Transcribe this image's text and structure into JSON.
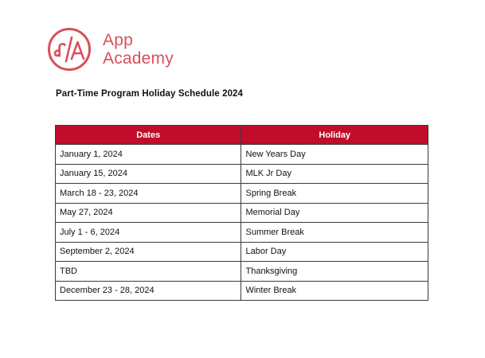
{
  "brand": {
    "mark_text": "a/A",
    "name_line1": "App",
    "name_line2": "Academy",
    "color": "#d8505a"
  },
  "document": {
    "title": "Part-Time Program Holiday Schedule 2024"
  },
  "table": {
    "header_color": "#c00d2a",
    "columns": [
      "Dates",
      "Holiday"
    ],
    "rows": [
      [
        "January 1, 2024",
        "New Years Day"
      ],
      [
        "January 15, 2024",
        "MLK Jr Day"
      ],
      [
        "March 18 - 23, 2024",
        "Spring Break"
      ],
      [
        "May 27, 2024",
        "Memorial Day"
      ],
      [
        "July 1 - 6, 2024",
        "Summer Break"
      ],
      [
        "September 2, 2024",
        "Labor Day"
      ],
      [
        "TBD",
        "Thanksgiving"
      ],
      [
        "December 23 - 28, 2024",
        "Winter Break"
      ]
    ]
  }
}
